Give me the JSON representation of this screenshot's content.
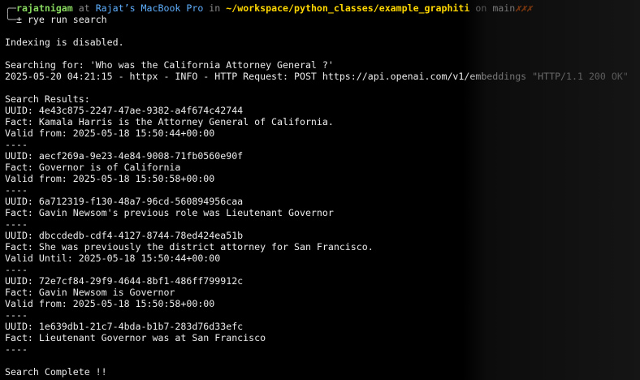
{
  "prompt": {
    "corner_top": "╭─",
    "corner_bottom": "╰─",
    "user": "rajatnigam",
    "at": " at ",
    "host": "Rajat’s MacBook Pro",
    "in": " in ",
    "path": "~/workspace/python_classes/example_graphiti",
    "on": " on ",
    "branch": "main",
    "dirty": "✗✗✗",
    "symbol": "± ",
    "command": "rye run search"
  },
  "output": {
    "indexing": "Indexing is disabled.",
    "searching": "Searching for: 'Who was the California Attorney General ?'",
    "http_log": "2025-05-20 04:21:15 - httpx - INFO - HTTP Request: POST https://api.openai.com/v1/embeddings \"HTTP/1.1 200 OK\"",
    "results_header": "Search Results:",
    "separator": "----",
    "results": [
      {
        "uuid": "UUID: 4e43c875-2247-47ae-9382-a4f674c42744",
        "fact": "Fact: Kamala Harris is the Attorney General of California.",
        "validity": "Valid from: 2025-05-18 15:50:44+00:00"
      },
      {
        "uuid": "UUID: aecf269a-9e23-4e84-9008-71fb0560e90f",
        "fact": "Fact: Governor is of California",
        "validity": "Valid from: 2025-05-18 15:50:58+00:00"
      },
      {
        "uuid": "UUID: 6a712319-f130-48a7-96cd-560894956caa",
        "fact": "Fact: Gavin Newsom's previous role was Lieutenant Governor",
        "validity": ""
      },
      {
        "uuid": "UUID: dbccdedb-cdf4-4127-8744-78ed424ea51b",
        "fact": "Fact: She was previously the district attorney for San Francisco.",
        "validity": "Valid Until: 2025-05-18 15:50:44+00:00"
      },
      {
        "uuid": "UUID: 72e7cf84-29f9-4644-8bf1-486ff799912c",
        "fact": "Fact: Gavin Newsom is Governor",
        "validity": "Valid from: 2025-05-18 15:50:58+00:00"
      },
      {
        "uuid": "UUID: 1e639db1-21c7-4bda-b1b7-283d76d33efc",
        "fact": "Fact: Lieutenant Governor was at San Francisco",
        "validity": ""
      }
    ],
    "complete": "Search Complete !!"
  }
}
